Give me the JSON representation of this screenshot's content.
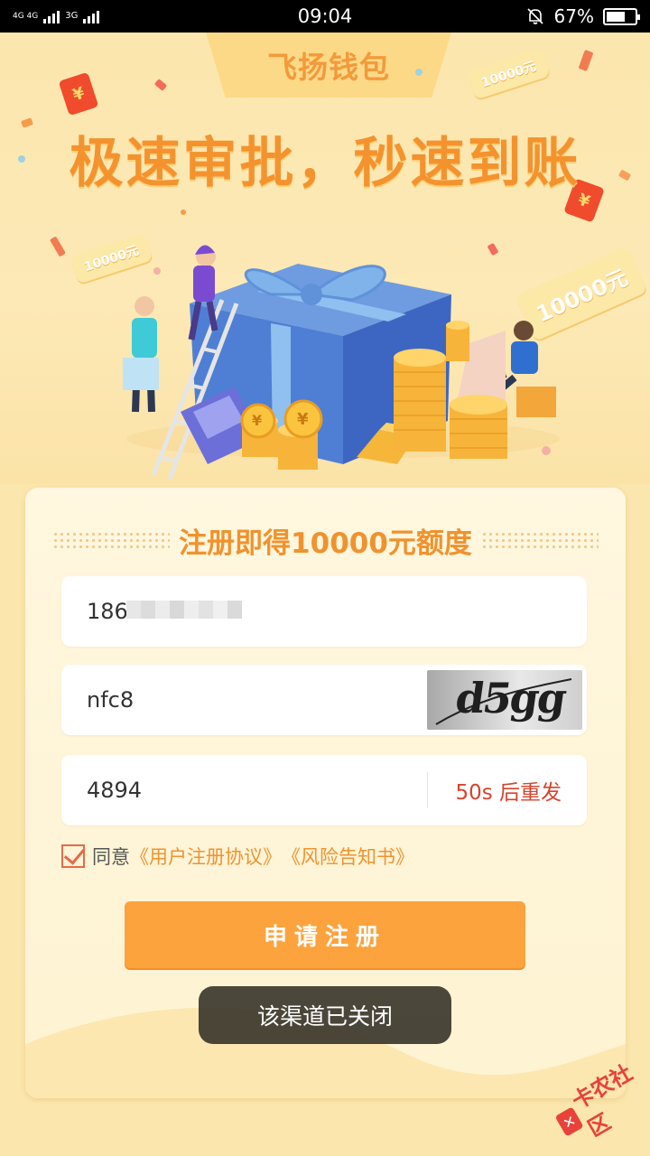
{
  "status_bar": {
    "network_1": "4G 4G",
    "network_2": "3G",
    "time": "09:04",
    "battery": "67%",
    "battery_level": 0.67
  },
  "banner": {
    "app_name": "飞扬钱包",
    "headline": "极速审批，秒速到账",
    "tag_left": "10000元",
    "tag_top": "10000元",
    "tag_right": "10000元",
    "redpack_symbol": "¥",
    "coin_symbol": "¥"
  },
  "form": {
    "title": "注册即得10000元额度",
    "phone_value": "186",
    "captcha_input_value": "nfc8",
    "captcha_image_text": "d5gg",
    "sms_code_value": "4894",
    "resend_label": "50s 后重发",
    "agree_prefix": "同意",
    "agreement_link_1": "《用户注册协议》",
    "agreement_link_2": "《风险告知书》",
    "submit_label": "申请注册"
  },
  "toast": "该渠道已关闭",
  "watermark": "卡农社区"
}
